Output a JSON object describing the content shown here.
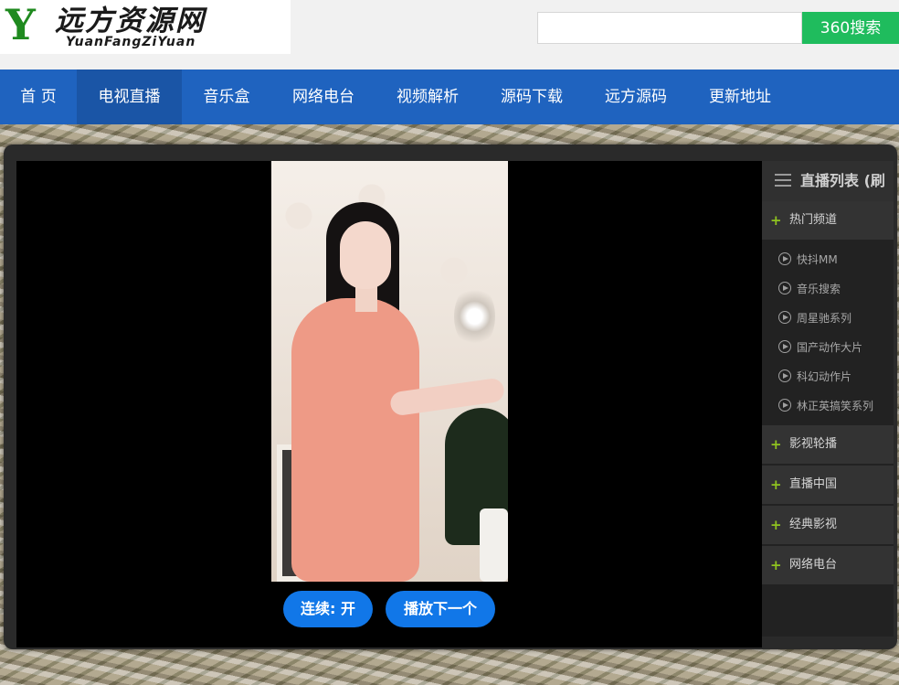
{
  "logo": {
    "mark": "Y",
    "title": "远方资源网",
    "subtitle": "YuanFangZiYuan"
  },
  "search": {
    "placeholder": "",
    "button_label": "360搜索"
  },
  "nav": {
    "items": [
      {
        "label": "首 页"
      },
      {
        "label": "电视直播",
        "active": true
      },
      {
        "label": "音乐盒"
      },
      {
        "label": "网络电台"
      },
      {
        "label": "视频解析"
      },
      {
        "label": "源码下载"
      },
      {
        "label": "远方源码"
      },
      {
        "label": "更新地址"
      }
    ]
  },
  "player": {
    "continuous_label": "连续: 开",
    "next_label": "播放下一个"
  },
  "sidebar": {
    "title": "直播列表 (刷",
    "groups": [
      {
        "label": "热门频道",
        "expanded": true,
        "channels": [
          "快抖MM",
          "音乐搜索",
          "周星驰系列",
          "国产动作大片",
          "科幻动作片",
          "林正英搞笑系列"
        ]
      },
      {
        "label": "影视轮播"
      },
      {
        "label": "直播中国"
      },
      {
        "label": "经典影视"
      },
      {
        "label": "网络电台"
      }
    ]
  },
  "colors": {
    "nav_bg": "#1f63bf",
    "search_button": "#1fbc5d",
    "player_button": "#1177e8",
    "plus_icon": "#8fc31f"
  }
}
